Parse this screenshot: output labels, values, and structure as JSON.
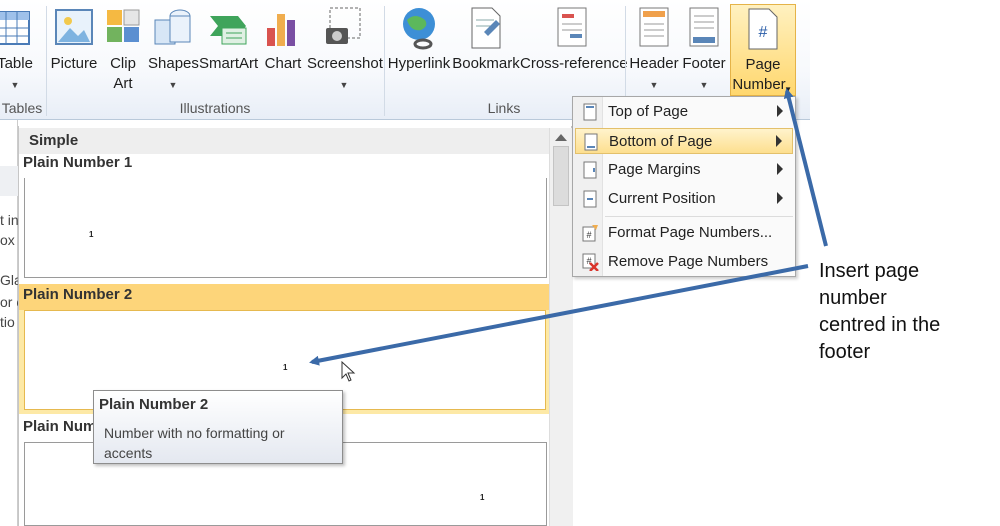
{
  "ribbon": {
    "buttons": [
      {
        "label": "Table",
        "icon": "table-icon"
      },
      {
        "label": "Picture",
        "icon": "picture-icon"
      },
      {
        "label": "Clip",
        "label2": "Art",
        "icon": "clip-art-icon"
      },
      {
        "label": "Shapes",
        "icon": "shapes-icon"
      },
      {
        "label": "SmartArt",
        "icon": "smartart-icon"
      },
      {
        "label": "Chart",
        "icon": "chart-icon"
      },
      {
        "label": "Screenshot",
        "icon": "screenshot-icon"
      },
      {
        "label": "Hyperlink",
        "icon": "hyperlink-icon"
      },
      {
        "label": "Bookmark",
        "icon": "bookmark-icon"
      },
      {
        "label": "Cross-reference",
        "icon": "cross-reference-icon"
      },
      {
        "label": "Header",
        "icon": "header-icon"
      },
      {
        "label": "Footer",
        "icon": "footer-icon"
      },
      {
        "label": "Page",
        "label2": "Number",
        "icon": "page-number-icon"
      }
    ],
    "groups": {
      "tables": "Tables",
      "illustrations": "Illustrations",
      "links": "Links"
    },
    "page_number_glyph": "#"
  },
  "gallery": {
    "section": "Simple",
    "items": [
      {
        "title": "Plain Number 1",
        "number": "1"
      },
      {
        "title": "Plain Number 2",
        "number": "1"
      },
      {
        "title": "Plain Num",
        "number": "1"
      }
    ]
  },
  "tooltip": {
    "title": "Plain Number 2",
    "description": "Number with no formatting or accents"
  },
  "menu": {
    "items": [
      {
        "label": "Top of Page",
        "submenu": true
      },
      {
        "label": "Bottom of Page",
        "submenu": true,
        "highlighted": true
      },
      {
        "label": "Page Margins",
        "submenu": true
      },
      {
        "label": "Current Position",
        "submenu": true
      },
      {
        "label": "Format Page Numbers...",
        "submenu": false
      },
      {
        "label": "Remove Page Numbers",
        "submenu": false
      }
    ]
  },
  "document_fragments": [
    "t in",
    "ox a",
    "Glas",
    "or c",
    "tio"
  ],
  "annotation": {
    "lines": [
      "Insert page",
      "number",
      "centred in the",
      "footer"
    ]
  },
  "colors": {
    "highlight": "#fdd57a",
    "arrow": "#3b6aa8"
  }
}
